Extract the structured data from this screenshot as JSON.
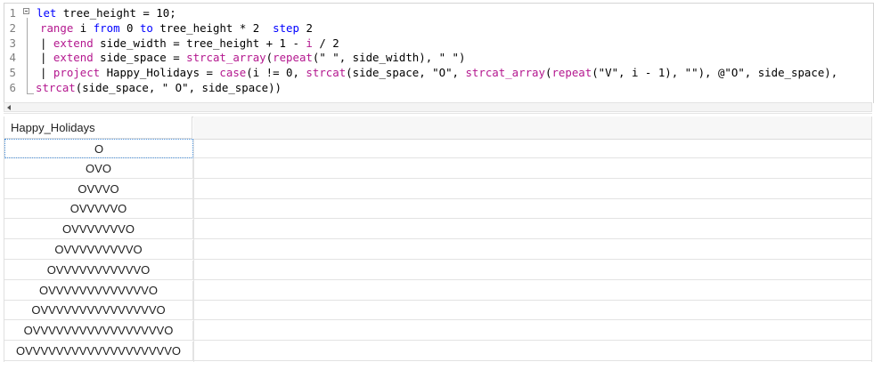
{
  "editor": {
    "lines": [
      {
        "n": "1",
        "tokens": [
          {
            "t": "let",
            "c": "kw"
          },
          {
            "t": " tree_height = 10;",
            "c": ""
          }
        ]
      },
      {
        "n": "2",
        "tokens": [
          {
            "t": "range",
            "c": "op"
          },
          {
            "t": " i ",
            "c": ""
          },
          {
            "t": "from",
            "c": "kw"
          },
          {
            "t": " 0 ",
            "c": ""
          },
          {
            "t": "to",
            "c": "kw"
          },
          {
            "t": " tree_height * 2  ",
            "c": ""
          },
          {
            "t": "step",
            "c": "kw"
          },
          {
            "t": " 2",
            "c": ""
          }
        ]
      },
      {
        "n": "3",
        "tokens": [
          {
            "t": "| ",
            "c": ""
          },
          {
            "t": "extend",
            "c": "op"
          },
          {
            "t": " side_width = tree_height + 1 - ",
            "c": ""
          },
          {
            "t": "i",
            "c": "op"
          },
          {
            "t": " / 2",
            "c": ""
          }
        ]
      },
      {
        "n": "4",
        "tokens": [
          {
            "t": "| ",
            "c": ""
          },
          {
            "t": "extend",
            "c": "op"
          },
          {
            "t": " side_space = ",
            "c": ""
          },
          {
            "t": "strcat_array",
            "c": "op"
          },
          {
            "t": "(",
            "c": ""
          },
          {
            "t": "repeat",
            "c": "op"
          },
          {
            "t": "(\" \", side_width), \" \")",
            "c": ""
          }
        ]
      },
      {
        "n": "5",
        "tokens": [
          {
            "t": "| ",
            "c": ""
          },
          {
            "t": "project",
            "c": "op"
          },
          {
            "t": " Happy_Holidays = ",
            "c": ""
          },
          {
            "t": "case",
            "c": "op"
          },
          {
            "t": "(i != 0, ",
            "c": ""
          },
          {
            "t": "strcat",
            "c": "op"
          },
          {
            "t": "(side_space, \"O\", ",
            "c": ""
          },
          {
            "t": "strcat_array",
            "c": "op"
          },
          {
            "t": "(",
            "c": ""
          },
          {
            "t": "repeat",
            "c": "op"
          },
          {
            "t": "(\"V\", i - 1), \"\"), @\"O\", side_space),",
            "c": ""
          }
        ]
      },
      {
        "n": "6",
        "tokens": [
          {
            "t": "strcat",
            "c": "op"
          },
          {
            "t": "(side_space, \" O\", side_space))",
            "c": ""
          }
        ]
      }
    ]
  },
  "grid": {
    "column_header": "Happy_Holidays",
    "rows": [
      "O",
      "OVO",
      "OVVVO",
      "OVVVVVO",
      "OVVVVVVVO",
      "OVVVVVVVVVO",
      "OVVVVVVVVVVVO",
      "OVVVVVVVVVVVVVO",
      "OVVVVVVVVVVVVVVVO",
      "OVVVVVVVVVVVVVVVVVO",
      "OVVVVVVVVVVVVVVVVVVVO"
    ]
  },
  "colors": {
    "keyword": "#0000ff",
    "operator": "#b4188f",
    "selection_border": "#4a90d9"
  }
}
